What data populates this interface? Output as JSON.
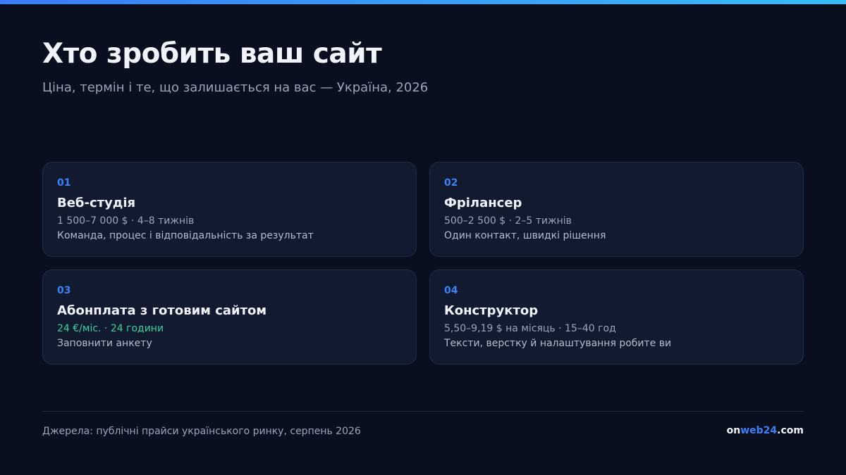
{
  "header": {
    "title": "Хто зробить ваш сайт",
    "subtitle": "Ціна, термін і те, що залишається на вас — Україна, 2026"
  },
  "cards": [
    {
      "number": "01",
      "title": "Веб-студія",
      "meta": "1 500–7 000 $ · 4–8 тижнів",
      "description": "Команда, процес і відповідальність за результат"
    },
    {
      "number": "02",
      "title": "Фрілансер",
      "meta": "500–2 500 $ · 2–5 тижнів",
      "description": "Один контакт, швидкі рішення"
    },
    {
      "number": "03",
      "title": "Абонплата з готовим сайтом",
      "meta": "24 €/міс. · 24 години",
      "description": "Заповнити анкету"
    },
    {
      "number": "04",
      "title": "Конструктор",
      "meta": "5,50–9,19 $ на місяць · 15–40 год",
      "description": "Тексти, верстку й налаштування робите ви"
    }
  ],
  "footer": {
    "source": "Джерела: публічні прайси українського ринку, серпень 2026",
    "brand_prefix": "on",
    "brand_highlight": "web24",
    "brand_suffix": ".com"
  },
  "colors": {
    "accent": "#3b82f6",
    "highlight_green": "#34d399",
    "background": "#0a0f1f",
    "card_background": "#121a30"
  }
}
